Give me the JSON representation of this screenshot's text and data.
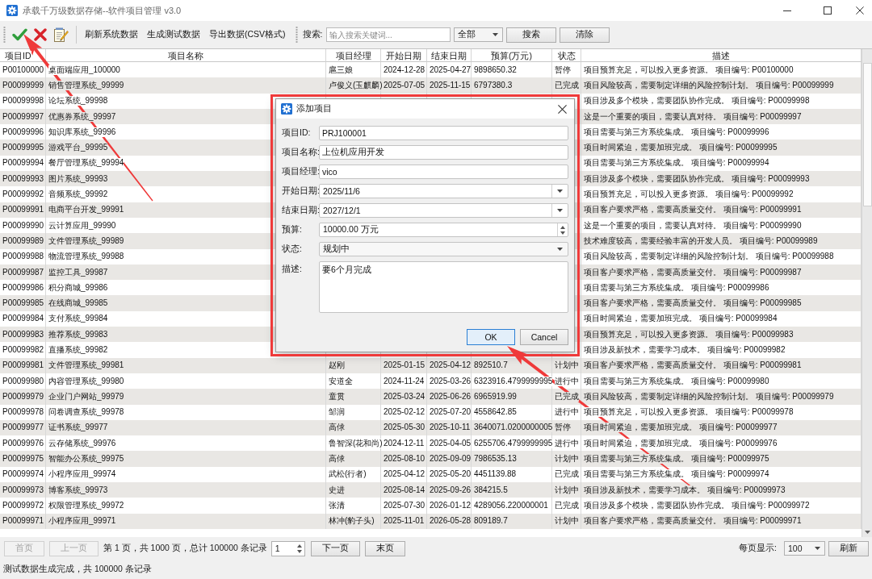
{
  "window": {
    "title": "承载千万级数据存储--软件项目管理 v3.0"
  },
  "toolbar": {
    "actions": [
      "刷新系统数据",
      "生成测试数据",
      "导出数据(CSV格式)"
    ],
    "search": {
      "label": "搜索:",
      "placeholder": "输入搜索关键词...",
      "filter": "全部",
      "buttons": [
        "搜索",
        "清除"
      ]
    }
  },
  "table": {
    "columns": [
      "项目ID",
      "项目名称",
      "项目经理",
      "开始日期",
      "结束日期",
      "预算(万元)",
      "状态",
      "描述"
    ],
    "rows": [
      {
        "id": "P00100000",
        "name": "桌面端应用_100000",
        "manager": "扈三娘",
        "start": "2024-12-28",
        "end": "2025-04-27",
        "budget": "9898650.32",
        "status": "暂停",
        "description": "项目预算充足，可以投入更多资源。 项目编号: P00100000"
      },
      {
        "id": "P00099999",
        "name": "销售管理系统_99999",
        "manager": "卢俊义(玉麒麟)",
        "start": "2025-07-05",
        "end": "2025-11-15",
        "budget": "6797380.3",
        "status": "已完成",
        "description": "项目风险较高，需要制定详细的风险控制计划。 项目编号: P00099999"
      },
      {
        "id": "P00099998",
        "name": "论坛系统_99998",
        "description": "项目涉及多个模块，需要团队协作完成。 项目编号: P00099998"
      },
      {
        "id": "P00099997",
        "name": "优惠券系统_99997",
        "description": "这是一个重要的项目，需要认真对待。 项目编号: P00099997"
      },
      {
        "id": "P00099996",
        "name": "知识库系统_99996",
        "description": "项目需要与第三方系统集成。 项目编号: P00099996"
      },
      {
        "id": "P00099995",
        "name": "游戏平台_99995",
        "description": "项目时间紧迫，需要加班完成。 项目编号: P00099995"
      },
      {
        "id": "P00099994",
        "name": "餐厅管理系统_99994",
        "description": "项目需要与第三方系统集成。 项目编号: P00099994"
      },
      {
        "id": "P00099993",
        "name": "图片系统_99993",
        "description": "项目涉及多个模块，需要团队协作完成。 项目编号: P00099993"
      },
      {
        "id": "P00099992",
        "name": "音频系统_99992",
        "description": "项目预算充足，可以投入更多资源。 项目编号: P00099992"
      },
      {
        "id": "P00099991",
        "name": "电商平台开发_99991",
        "description": "项目客户要求严格，需要高质量交付。 项目编号: P00099991"
      },
      {
        "id": "P00099990",
        "name": "云计算应用_99990",
        "description": "这是一个重要的项目，需要认真对待。 项目编号: P00099990"
      },
      {
        "id": "P00099989",
        "name": "文件管理系统_99989",
        "description": "技术难度较高，需要经验丰富的开发人员。 项目编号: P00099989"
      },
      {
        "id": "P00099988",
        "name": "物流管理系统_99988",
        "description": "项目风险较高，需要制定详细的风险控制计划。 项目编号: P00099988"
      },
      {
        "id": "P00099987",
        "name": "监控工具_99987",
        "description": "项目客户要求严格，需要高质量交付。 项目编号: P00099987"
      },
      {
        "id": "P00099986",
        "name": "积分商城_99986",
        "description": "项目需要与第三方系统集成。 项目编号: P00099986"
      },
      {
        "id": "P00099985",
        "name": "在线商城_99985",
        "description": "项目客户要求严格，需要高质量交付。 项目编号: P00099985"
      },
      {
        "id": "P00099984",
        "name": "支付系统_99984",
        "description": "项目时间紧迫，需要加班完成。 项目编号: P00099984"
      },
      {
        "id": "P00099983",
        "name": "推荐系统_99983",
        "description": "项目预算充足，可以投入更多资源。 项目编号: P00099983"
      },
      {
        "id": "P00099982",
        "name": "直播系统_99982",
        "description": "项目涉及新技术，需要学习成本。 项目编号: P00099982"
      },
      {
        "id": "P00099981",
        "name": "文件管理系统_99981",
        "manager": "赵刚",
        "start": "2025-01-15",
        "end": "2025-04-12",
        "budget": "892510.7",
        "status": "计划中",
        "description": "项目客户要求严格，需要高质量交付。 项目编号: P00099981"
      },
      {
        "id": "P00099980",
        "name": "内容管理系统_99980",
        "manager": "安道全",
        "start": "2024-11-24",
        "end": "2025-03-26",
        "budget": "6323916.4799999995",
        "status": "进行中",
        "description": "项目需要与第三方系统集成。 项目编号: P00099980"
      },
      {
        "id": "P00099979",
        "name": "企业门户网站_99979",
        "manager": "童贯",
        "start": "2025-03-24",
        "end": "2025-06-26",
        "budget": "6965919.99",
        "status": "已完成",
        "description": "项目风险较高，需要制定详细的风险控制计划。 项目编号: P00099979"
      },
      {
        "id": "P00099978",
        "name": "问卷调查系统_99978",
        "manager": "邹润",
        "start": "2025-02-12",
        "end": "2025-07-20",
        "budget": "4558642.85",
        "status": "进行中",
        "description": "项目预算充足，可以投入更多资源。 项目编号: P00099978"
      },
      {
        "id": "P00099977",
        "name": "证书系统_99977",
        "manager": "高俅",
        "start": "2025-05-30",
        "end": "2025-10-11",
        "budget": "3640071.0200000005",
        "status": "暂停",
        "description": "项目时间紧迫，需要加班完成。 项目编号: P00099977"
      },
      {
        "id": "P00099976",
        "name": "云存储系统_99976",
        "manager": "鲁智深(花和尚)",
        "start": "2024-12-11",
        "end": "2025-04-05",
        "budget": "6255706.4799999995",
        "status": "进行中",
        "description": "项目时间紧迫，需要加班完成。 项目编号: P00099976"
      },
      {
        "id": "P00099975",
        "name": "智能办公系统_99975",
        "manager": "高俅",
        "start": "2025-08-10",
        "end": "2025-09-09",
        "budget": "7986535.13",
        "status": "计划中",
        "description": "项目需要与第三方系统集成。 项目编号: P00099975"
      },
      {
        "id": "P00099974",
        "name": "小程序应用_99974",
        "manager": "武松(行者)",
        "start": "2025-04-12",
        "end": "2025-05-20",
        "budget": "4451139.88",
        "status": "已完成",
        "description": "项目需要与第三方系统集成。 项目编号: P00099974"
      },
      {
        "id": "P00099973",
        "name": "博客系统_99973",
        "manager": "史进",
        "start": "2025-08-14",
        "end": "2025-09-26",
        "budget": "384215.5",
        "status": "计划中",
        "description": "项目涉及新技术，需要学习成本。 项目编号: P00099973"
      },
      {
        "id": "P00099972",
        "name": "权限管理系统_99972",
        "manager": "张清",
        "start": "2025-07-30",
        "end": "2026-01-12",
        "budget": "4289056.220000001",
        "status": "已完成",
        "description": "项目涉及多个模块，需要团队协作完成。 项目编号: P00099972"
      },
      {
        "id": "P00099971",
        "name": "小程序应用_99971",
        "manager": "林冲(豹子头)",
        "start": "2025-11-01",
        "end": "2026-05-28",
        "budget": "809189.7",
        "status": "计划中",
        "description": "项目客户要求严格，需要高质量交付。 项目编号: P00099971"
      }
    ]
  },
  "dialog": {
    "title": "添加项目",
    "fields": [
      {
        "label": "项目ID:",
        "kind": "text",
        "value": "PRJ100001"
      },
      {
        "label": "项目名称:",
        "kind": "text",
        "value": "上位机应用开发"
      },
      {
        "label": "项目经理:",
        "kind": "text",
        "value": "vico"
      },
      {
        "label": "开始日期:",
        "kind": "date",
        "value": "2025/11/6"
      },
      {
        "label": "结束日期:",
        "kind": "date",
        "value": "2027/12/1"
      },
      {
        "label": "预算:",
        "kind": "spin",
        "value": "10000.00 万元"
      },
      {
        "label": "状态:",
        "kind": "select",
        "value": "规划中"
      },
      {
        "label": "描述:",
        "kind": "textarea",
        "value": "要6个月完成"
      }
    ],
    "buttons": [
      {
        "label": "OK",
        "focused": true
      },
      {
        "label": "Cancel",
        "focused": false
      }
    ]
  },
  "pagination": {
    "prev_buttons": [
      {
        "label": "首页",
        "disabled": true
      },
      {
        "label": "上一页",
        "disabled": true
      }
    ],
    "summary": "第 1 页，共 1000 页，总计 100000 条记录",
    "page": "1",
    "next_buttons": [
      {
        "label": "下一页",
        "disabled": false
      },
      {
        "label": "末页",
        "disabled": false
      }
    ],
    "page_size_label": "每页显示:",
    "page_size": "100",
    "refresh": "刷新"
  },
  "status_bar": "测试数据生成完成，共 100000 条记录"
}
